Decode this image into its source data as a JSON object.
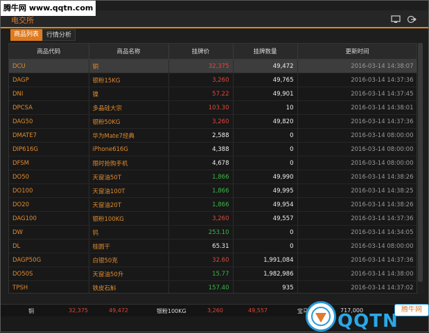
{
  "watermark": "腾牛网 www.qqtn.com",
  "app": {
    "title": "电交所"
  },
  "tabs": [
    {
      "label": "商品列表"
    },
    {
      "label": "行情分析"
    }
  ],
  "table": {
    "columns": [
      "商品代码",
      "商品名称",
      "挂牌价",
      "挂牌数量",
      "更新时间"
    ],
    "rows": [
      {
        "code": "DCU",
        "name": "铜",
        "price": "32,375",
        "price_color": "red",
        "qty": "49,472",
        "time": "2016-03-14 14:38:07"
      },
      {
        "code": "DAGP",
        "name": "银粉15KG",
        "price": "3,260",
        "price_color": "red",
        "qty": "49,765",
        "time": "2016-03-14 14:37:36"
      },
      {
        "code": "DNI",
        "name": "镍",
        "price": "57.22",
        "price_color": "red",
        "qty": "49,901",
        "time": "2016-03-14 14:37:45"
      },
      {
        "code": "DPCSA",
        "name": "多晶硅大宗",
        "price": "103.30",
        "price_color": "red",
        "qty": "10",
        "time": "2016-03-14 14:38:01"
      },
      {
        "code": "DAG50",
        "name": "银粉50KG",
        "price": "3,260",
        "price_color": "red",
        "qty": "49,820",
        "time": "2016-03-14 14:37:36"
      },
      {
        "code": "DMATE7",
        "name": "华为Mate7经典",
        "price": "2,588",
        "price_color": "white",
        "qty": "0",
        "time": "2016-03-14 08:00:00"
      },
      {
        "code": "DIP616G",
        "name": "iPhone616G",
        "price": "4,388",
        "price_color": "white",
        "qty": "0",
        "time": "2016-03-14 08:00:00"
      },
      {
        "code": "DFSM",
        "name": "限时抢购手机",
        "price": "4,678",
        "price_color": "white",
        "qty": "0",
        "time": "2016-03-14 08:00:00"
      },
      {
        "code": "DO50",
        "name": "天窗油50T",
        "price": "1,866",
        "price_color": "green",
        "qty": "49,990",
        "time": "2016-03-14 14:38:26"
      },
      {
        "code": "DO100",
        "name": "天窗油100T",
        "price": "1,866",
        "price_color": "green",
        "qty": "49,995",
        "time": "2016-03-14 14:38:25"
      },
      {
        "code": "DO20",
        "name": "天窗油20T",
        "price": "1,866",
        "price_color": "green",
        "qty": "49,954",
        "time": "2016-03-14 14:38:26"
      },
      {
        "code": "DAG100",
        "name": "银粉100KG",
        "price": "3,260",
        "price_color": "red",
        "qty": "49,557",
        "time": "2016-03-14 14:37:36"
      },
      {
        "code": "DW",
        "name": "钨",
        "price": "253.10",
        "price_color": "green",
        "qty": "0",
        "time": "2016-03-14 14:34:05"
      },
      {
        "code": "DL",
        "name": "桂圆干",
        "price": "65.31",
        "price_color": "white",
        "qty": "0",
        "time": "2016-03-14 08:00:00"
      },
      {
        "code": "DAGP50G",
        "name": "白银50克",
        "price": "32.60",
        "price_color": "red",
        "qty": "1,991,084",
        "time": "2016-03-14 14:37:36"
      },
      {
        "code": "DO50S",
        "name": "天窗油50升",
        "price": "15.77",
        "price_color": "green",
        "qty": "1,982,986",
        "time": "2016-03-14 14:38:00"
      },
      {
        "code": "TPSH",
        "name": "铁皮石斛",
        "price": "157.40",
        "price_color": "green",
        "qty": "935",
        "time": "2016-03-14 14:37:02"
      }
    ]
  },
  "status": {
    "item1_name": "铜",
    "item1_price": "32,375",
    "item1_qty": "49,472",
    "item2_name": "银粉100KG",
    "item2_price": "3,260",
    "item2_qty": "49,557",
    "item3_name": "宝马",
    "item3_qty": "717,000"
  },
  "logo": {
    "text": "QQTN",
    "sub": "腾牛网"
  },
  "colors": {
    "accent": "#e07a1e",
    "red": "#e0483a",
    "green": "#3cb84a"
  }
}
